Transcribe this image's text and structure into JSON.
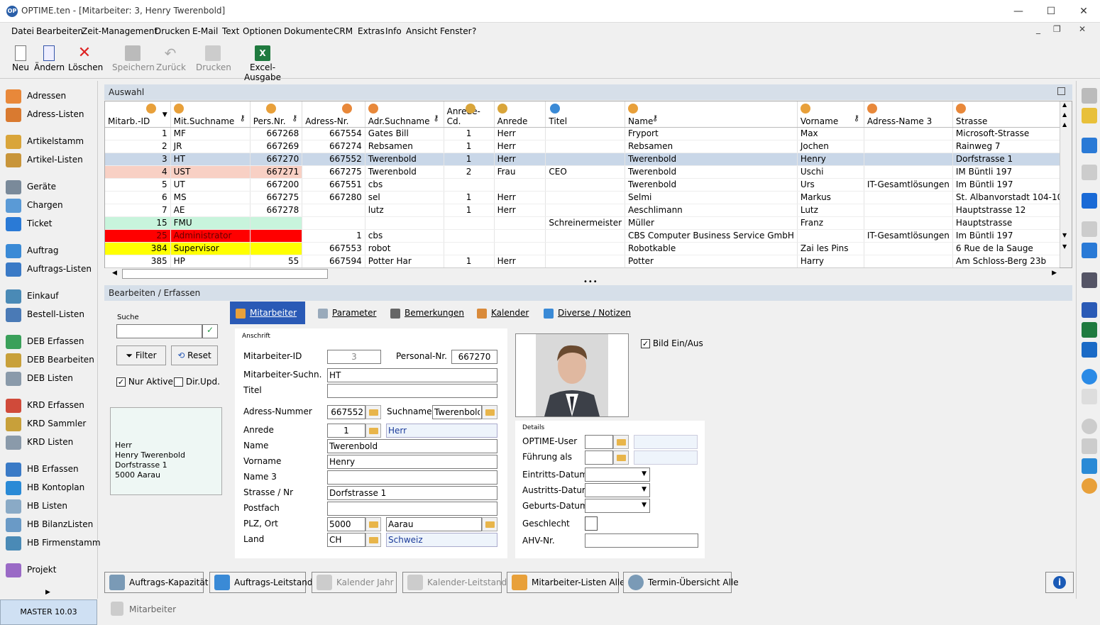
{
  "window": {
    "logo": "OP",
    "title": "OPTIME.ten  - [Mitarbeiter: 3, Henry Twerenbold]"
  },
  "menu": [
    "Datei",
    "Bearbeiten",
    "Zeit-Management",
    "Drucken",
    "E-Mail",
    "Text",
    "Optionen",
    "Dokumente",
    "CRM",
    "Extras",
    "Info",
    "Ansicht",
    "Fenster",
    "?"
  ],
  "toolbar": [
    {
      "label": "Neu",
      "icon": "new-document-icon",
      "enabled": true
    },
    {
      "label": "Ändern",
      "icon": "edit-document-icon",
      "enabled": true
    },
    {
      "label": "Löschen",
      "icon": "delete-x-icon",
      "enabled": true
    },
    {
      "label": "Speichern",
      "icon": "save-icon",
      "enabled": false
    },
    {
      "label": "Zurück",
      "icon": "undo-icon",
      "enabled": false
    },
    {
      "label": "Drucken",
      "icon": "printer-icon",
      "enabled": false
    },
    {
      "label": "Excel-Ausgabe",
      "icon": "excel-icon",
      "enabled": true
    }
  ],
  "nav": [
    "Adressen",
    "Adress-Listen",
    "Artikelstamm",
    "Artikel-Listen",
    "Geräte",
    "Chargen",
    "Ticket",
    "Auftrag",
    "Auftrags-Listen",
    "Einkauf",
    "Bestell-Listen",
    "DEB Erfassen",
    "DEB Bearbeiten",
    "DEB Listen",
    "KRD Erfassen",
    "KRD Sammler",
    "KRD Listen",
    "HB Erfassen",
    "HB Kontoplan",
    "HB Listen",
    "HB BilanzListen",
    "HB Firmenstamm",
    "Projekt"
  ],
  "status": {
    "master": "MASTER   10.03",
    "module": "Mitarbeiter"
  },
  "auswahl": {
    "title": "Auswahl"
  },
  "grid": {
    "columns": [
      "Mitarb.-ID",
      "Mit.Suchname",
      "Pers.Nr.",
      "Adress-Nr.",
      "Adr.Suchname",
      "Anrede-Cd.",
      "Anrede",
      "Titel",
      "Name",
      "Vorname",
      "Adress-Name 3",
      "Strasse"
    ],
    "rows": [
      [
        "1",
        "MF",
        "667268",
        "667554",
        "Gates Bill",
        "1",
        "Herr",
        "",
        "Fryport",
        "Max",
        "",
        "Microsoft-Strasse"
      ],
      [
        "2",
        "JR",
        "667269",
        "667274",
        "Rebsamen",
        "1",
        "Herr",
        "",
        "Rebsamen",
        "Jochen",
        "",
        "Rainweg 7"
      ],
      [
        "3",
        "HT",
        "667270",
        "667552",
        "Twerenbold",
        "1",
        "Herr",
        "",
        "Twerenbold",
        "Henry",
        "",
        "Dorfstrasse 1"
      ],
      [
        "4",
        "UST",
        "667271",
        "667275",
        "Twerenbold",
        "2",
        "Frau",
        "CEO",
        "Twerenbold",
        "Uschi",
        "",
        "IM Büntli 197"
      ],
      [
        "5",
        "UT",
        "667200",
        "667551",
        "cbs",
        "",
        "",
        "",
        "Twerenbold",
        "Urs",
        "IT-Gesamtlösungen",
        "Im Büntli 197"
      ],
      [
        "6",
        "MS",
        "667275",
        "667280",
        "sel",
        "1",
        "Herr",
        "",
        "Selmi",
        "Markus",
        "",
        "St. Albanvorstadt 104-108"
      ],
      [
        "7",
        "AE",
        "667278",
        "",
        "lutz",
        "1",
        "Herr",
        "",
        "Aeschlimann",
        "Lutz",
        "",
        "Hauptstrasse 12"
      ],
      [
        "15",
        "FMU",
        "",
        "",
        "",
        "",
        "",
        "Schreinermeister",
        "Müller",
        "Franz",
        "",
        "Hauptstrasse"
      ],
      [
        "25",
        "Administrator",
        "",
        "1",
        "cbs",
        "",
        "",
        "",
        "CBS Computer Business Service GmbH",
        "",
        "IT-Gesamtlösungen",
        "Im Büntli 197"
      ],
      [
        "384",
        "Supervisor",
        "",
        "667553",
        "robot",
        "",
        "",
        "",
        "Robotkable",
        "Zai les Pins",
        "",
        "6 Rue de la Sauge"
      ],
      [
        "385",
        "HP",
        "55",
        "667594",
        "Potter Har",
        "1",
        "Herr",
        "",
        "Potter",
        "Harry",
        "",
        "Am Schloss-Berg 23b"
      ]
    ],
    "row_colors": [
      "",
      "",
      "#c9d7e8",
      "#f8d0c4",
      "",
      "",
      "",
      "#c8f4dc",
      "#ff0000",
      "#ffff00",
      ""
    ]
  },
  "edit": {
    "title": "Bearbeiten / Erfassen",
    "search_label": "Suche",
    "search_value": "",
    "filter": "Filter",
    "reset": "Reset",
    "nur_aktive": "Nur Aktive",
    "dir_upd": "Dir.Upd.",
    "address_block": [
      "Herr",
      "Henry Twerenbold",
      "Dorfstrasse 1",
      "5000 Aarau"
    ],
    "tabs": [
      "Mitarbeiter",
      "Parameter",
      "Bemerkungen",
      "Kalender",
      "Diverse / Notizen"
    ],
    "anschrift": "Anschrift",
    "f": {
      "mid_l": "Mitarbeiter-ID",
      "mid": "3",
      "pnr_l": "Personal-Nr.",
      "pnr": "667270",
      "suchn_l": "Mitarbeiter-Suchn.",
      "suchn": "HT",
      "titel_l": "Titel",
      "titel": "",
      "adr_l": "Adress-Nummer",
      "adr": "667552",
      "sn_l": "Suchname",
      "sn": "Twerenbold",
      "anr_l": "Anrede",
      "anr": "1",
      "anr_t": "Herr",
      "name_l": "Name",
      "name": "Twerenbold",
      "vn_l": "Vorname",
      "vn": "Henry",
      "n3_l": "Name 3",
      "n3": "",
      "str_l": "Strasse / Nr",
      "str": "Dorfstrasse 1",
      "pf_l": "Postfach",
      "pf": "",
      "plz_l": "PLZ, Ort",
      "plz": "5000",
      "ort": "Aarau",
      "land_l": "Land",
      "land": "CH",
      "land_t": "Schweiz"
    },
    "bild": "Bild Ein/Aus",
    "details": "Details",
    "d": {
      "user_l": "OPTIME-User",
      "fuehr_l": "Führung als",
      "ein_l": "Eintritts-Datum",
      "aus_l": "Austritts-Datum",
      "geb_l": "Geburts-Datum",
      "ges_l": "Geschlecht",
      "ahv_l": "AHV-Nr."
    }
  },
  "bottom": [
    {
      "label": "Auftrags-Kapazität",
      "enabled": true
    },
    {
      "label": "Auftrags-Leitstand",
      "enabled": true
    },
    {
      "label": "Kalender Jahr",
      "enabled": false
    },
    {
      "label": "Kalender-Leitstand",
      "enabled": false
    },
    {
      "label": "Mitarbeiter-Listen Alle",
      "enabled": true
    },
    {
      "label": "Termin-Übersicht Alle",
      "enabled": true
    }
  ]
}
